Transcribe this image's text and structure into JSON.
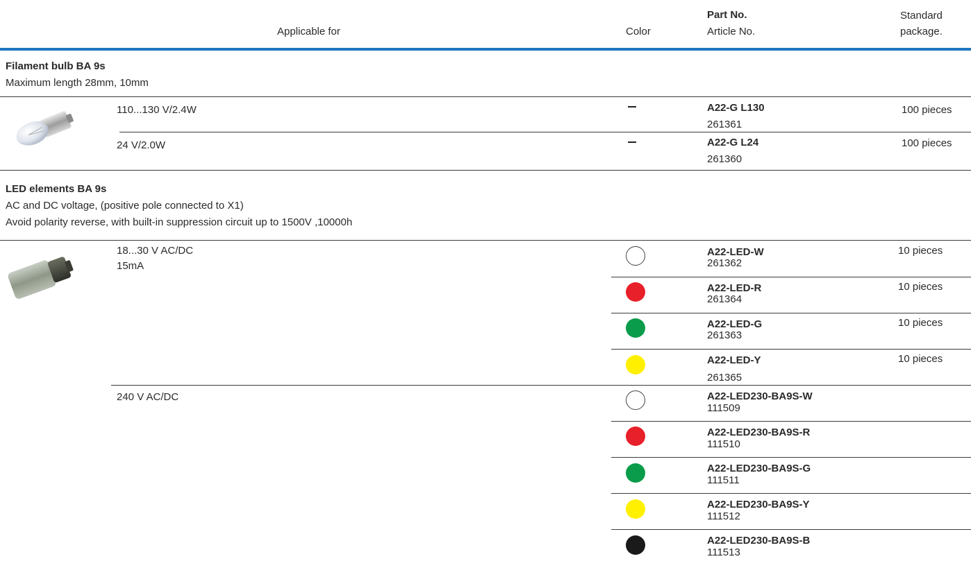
{
  "header": {
    "applicable": "Applicable for",
    "color": "Color",
    "part_no": "Part No.",
    "article_no": "Article No.",
    "standard1": "Standard",
    "standard2": "package."
  },
  "filament": {
    "title": "Filament bulb BA 9s",
    "subtitle": "Maximum length 28mm, 10mm",
    "rows": [
      {
        "applicable": "110...130 V/2.4W",
        "part": "A22-G L130",
        "article": "261361",
        "package": "100 pieces"
      },
      {
        "applicable": "24 V/2.0W",
        "part": "A22-G L24",
        "article": "261360",
        "package": "100 pieces"
      }
    ]
  },
  "led": {
    "title": "LED elements BA 9s",
    "sub1": "AC and DC voltage, (positive pole connected to X1)",
    "sub2": "Avoid polarity reverse, with built-in suppression circuit up to 1500V ,10000h",
    "group1": {
      "applicable1": "18...30 V AC/DC",
      "applicable2": "15mA",
      "rows": [
        {
          "part": "A22-LED-W",
          "article": "261362",
          "package": "10 pieces",
          "color": "#ffffff"
        },
        {
          "part": "A22-LED-R",
          "article": "261364",
          "package": "10 pieces",
          "color": "#e8202a"
        },
        {
          "part": "A22-LED-G",
          "article": "261363",
          "package": "10 pieces",
          "color": "#0a9c4a"
        },
        {
          "part": "A22-LED-Y",
          "article": "261365",
          "package": "10 pieces",
          "color": "#fff000"
        }
      ]
    },
    "group2": {
      "applicable": "240 V AC/DC",
      "rows": [
        {
          "part": "A22-LED230-BA9S-W",
          "article": "111509",
          "color": "#ffffff"
        },
        {
          "part": "A22-LED230-BA9S-R",
          "article": "111510",
          "color": "#e8202a"
        },
        {
          "part": "A22-LED230-BA9S-G",
          "article": "111511",
          "color": "#0a9c4a"
        },
        {
          "part": "A22-LED230-BA9S-Y",
          "article": "111512",
          "color": "#fff000"
        },
        {
          "part": "A22-LED230-BA9S-B",
          "article": "111513",
          "color": "#1a1a1a"
        }
      ]
    }
  }
}
